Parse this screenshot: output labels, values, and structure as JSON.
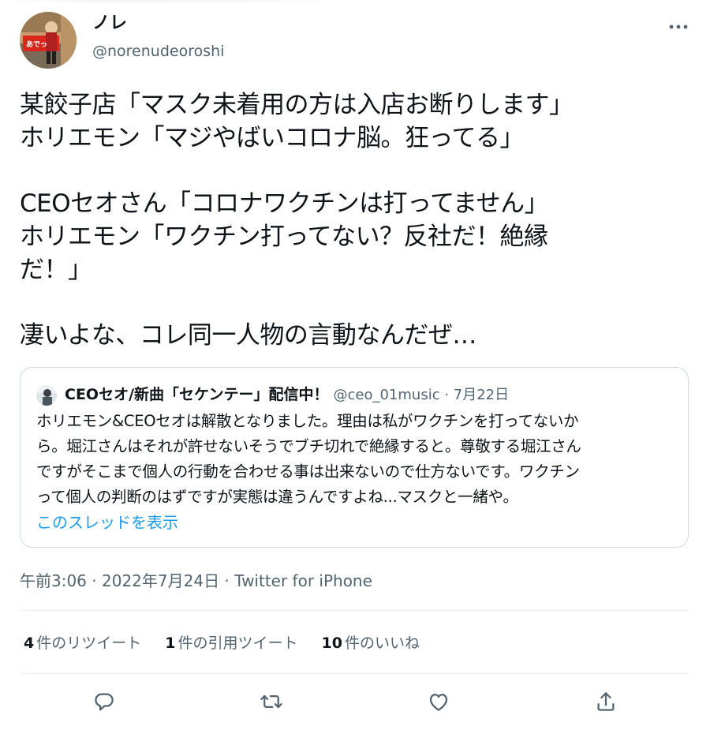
{
  "author": {
    "name": "ノレ",
    "handle": "@norenudeoroshi",
    "avatar_sign_text": "あでっ"
  },
  "tweet": {
    "lines": [
      "某餃子店「マスク未着用の方は入店お断りします」",
      "ホリエモン「マジやばいコロナ脳。狂ってる」",
      "",
      "CEOセオさん「コロナワクチンは打ってません」",
      "ホリエモン「ワクチン打ってない？反社だ！絶縁",
      "だ！」",
      "",
      "凄いよな、コレ同一人物の言動なんだぜ…"
    ]
  },
  "quoted_tweet": {
    "name": "CEOセオ/新曲「セケンテー」配信中！",
    "handle": "@ceo_01music",
    "separator": " · ",
    "date": "7月22日",
    "lines": [
      "ホリエモン&CEOセオは解散となりました。理由は私がワクチンを打ってないか",
      "ら。堀江さんはそれが許せないそうでブチ切れで絶縁すると。尊敬する堀江さん",
      "ですがそこまで個人の行動を合わせる事は出来ないので仕方ないです。ワクチン",
      "って個人の判断のはずですが実態は違うんですよね...マスクと一緒や。"
    ],
    "show_thread": "このスレッドを表示"
  },
  "meta": {
    "time": "午前3:06",
    "separator": " · ",
    "date": "2022年7月24日",
    "source": "Twitter for iPhone"
  },
  "stats": {
    "retweets_count": "4",
    "retweets_label": "件のリツイート",
    "quotes_count": "1",
    "quotes_label": "件の引用ツイート",
    "likes_count": "10",
    "likes_label": "件のいいね"
  },
  "icons": {
    "more": "more-icon",
    "reply": "reply-icon",
    "retweet": "retweet-icon",
    "like": "like-icon",
    "share": "share-icon"
  },
  "colors": {
    "text": "#0f1419",
    "secondary": "#536471",
    "link": "#1d9bf0",
    "border": "#cfd9de"
  }
}
